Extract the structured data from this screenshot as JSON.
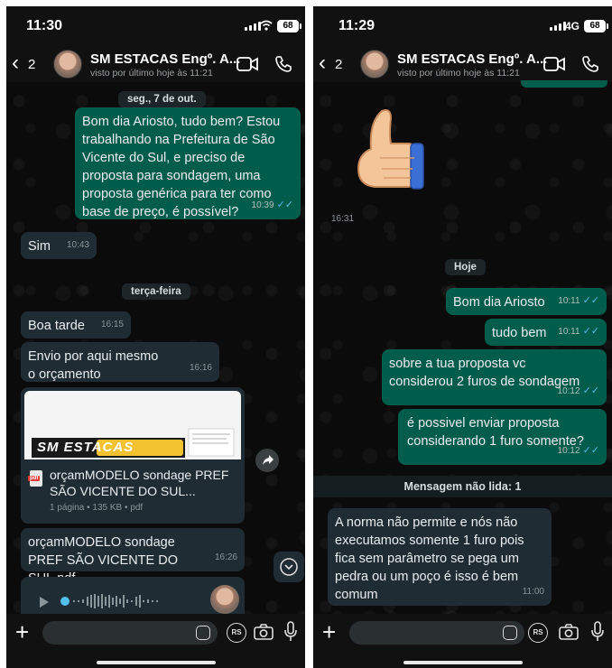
{
  "left": {
    "status": {
      "time": "11:30",
      "battery": "68"
    },
    "header": {
      "back_count": "2",
      "name": "SM ESTACAS Engº. A...",
      "last_seen": "visto por último hoje às 11:21"
    },
    "messages": {
      "date1": "seg., 7 de out.",
      "m1": "Bom dia Ariosto, tudo bem? Estou trabalhando na Prefeitura de São Vicente do Sul, e preciso de proposta para sondagem, uma proposta genérica para ter como base de preço, é possível?",
      "m1_time": "10:39",
      "m2": "Sim",
      "m2_time": "10:43",
      "date2": "terça-feira",
      "m3": "Boa tarde",
      "m3_time": "16:15",
      "m4": "Envio por aqui mesmo o orçamento",
      "m4_time": "16:16",
      "doc_name": "orçamMODELO sondage PREF SÃO VICENTE DO SUL...",
      "doc_meta": "1 página • 135 KB • pdf",
      "doc_logo": "SM ESTACAS",
      "m5": "orçamMODELO sondage PREF SÃO VICENTE DO SUL.pdf",
      "m5_time": "16:26"
    }
  },
  "right": {
    "status": {
      "time": "11:29",
      "network": "4G",
      "battery": "68"
    },
    "header": {
      "back_count": "2",
      "name": "SM ESTACAS Engº. A...",
      "last_seen": "visto por último hoje às 11:21"
    },
    "messages": {
      "sticker_time": "16:31",
      "date": "Hoje",
      "r1": "Bom dia Ariosto",
      "r1_time": "10:11",
      "r2": "tudo bem",
      "r2_time": "10:11",
      "r3": "sobre a tua proposta vc considerou 2 furos de sondagem",
      "r3_time": "10:12",
      "r4": "é possivel enviar proposta considerando 1 furo somente?",
      "r4_time": "10:12",
      "unread": "Mensagem não lida: 1",
      "r5": "A norma não permite e nós não executamos somente 1 furo pois fica sem parâmetro se pega um pedra ou um poço é isso é bem comum",
      "r5_time": "11:00"
    }
  },
  "input": {
    "rs_label": "RS"
  },
  "colors": {
    "outgoing": "#005c4b",
    "incoming": "#202c33",
    "read_ticks": "#53bdeb"
  }
}
